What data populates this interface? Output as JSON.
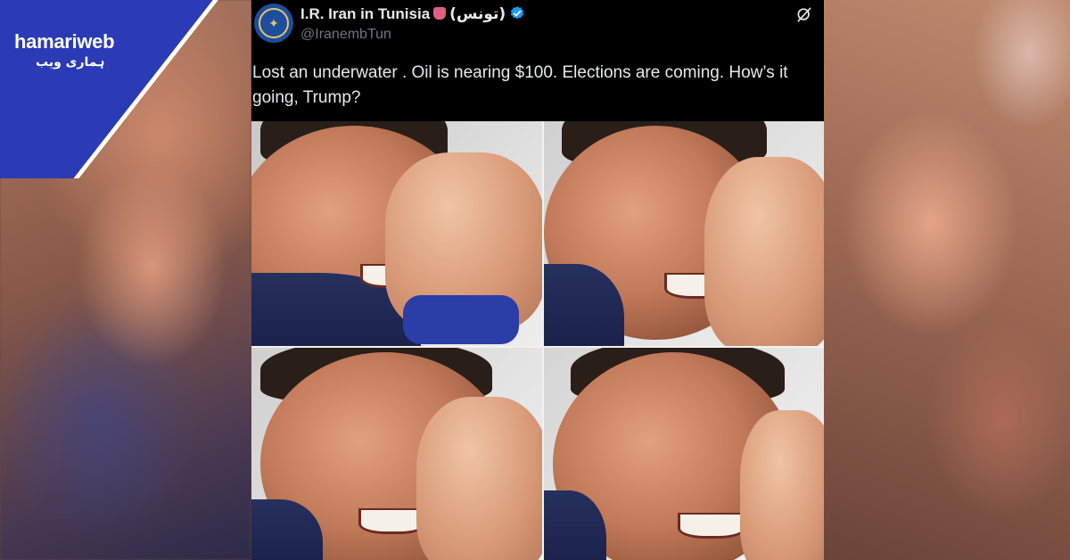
{
  "watermark": {
    "brand": "hamariweb",
    "brand_urdu": "ہماری ویب",
    "brand_color": "#2a3bb5"
  },
  "tweet": {
    "display_name": "I.R. Iran in Tunisia",
    "display_name_arabic": "(تونس)",
    "handle": "@IranembTun",
    "verified": true,
    "verified_color": "#1d9bf0",
    "avatar_icon": "emblem-icon",
    "text": "Lost an underwater . Oil is nearing $100. Elections are coming. How’s it going, Trump?",
    "image_grid": {
      "panels": 4
    }
  },
  "colors": {
    "tweet_bg": "#000000",
    "text": "#e7e9ea",
    "secondary_text": "#71767b"
  }
}
